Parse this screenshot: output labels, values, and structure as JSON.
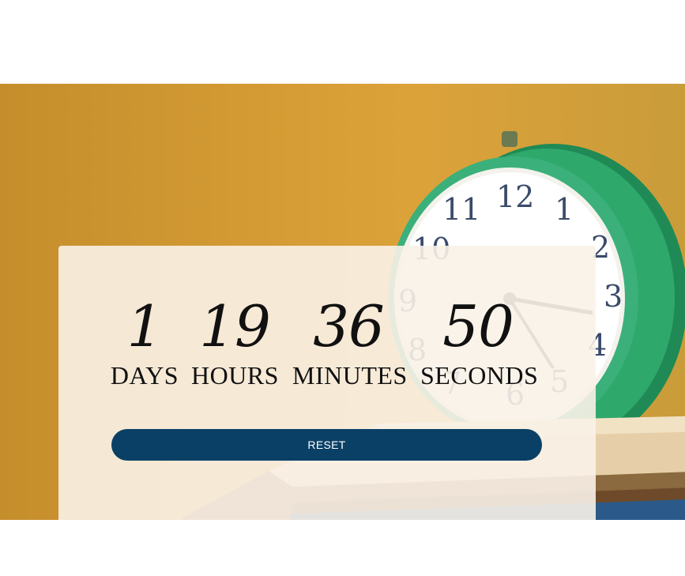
{
  "countdown": {
    "days": {
      "value": "1",
      "label": "DAYS"
    },
    "hours": {
      "value": "19",
      "label": "HOURS"
    },
    "minutes": {
      "value": "36",
      "label": "MINUTES"
    },
    "seconds": {
      "value": "50",
      "label": "SECONDS"
    }
  },
  "actions": {
    "reset_label": "RESET"
  },
  "colors": {
    "button": "#0b4066",
    "card": "#faf2e8",
    "background": "#d39a33"
  }
}
